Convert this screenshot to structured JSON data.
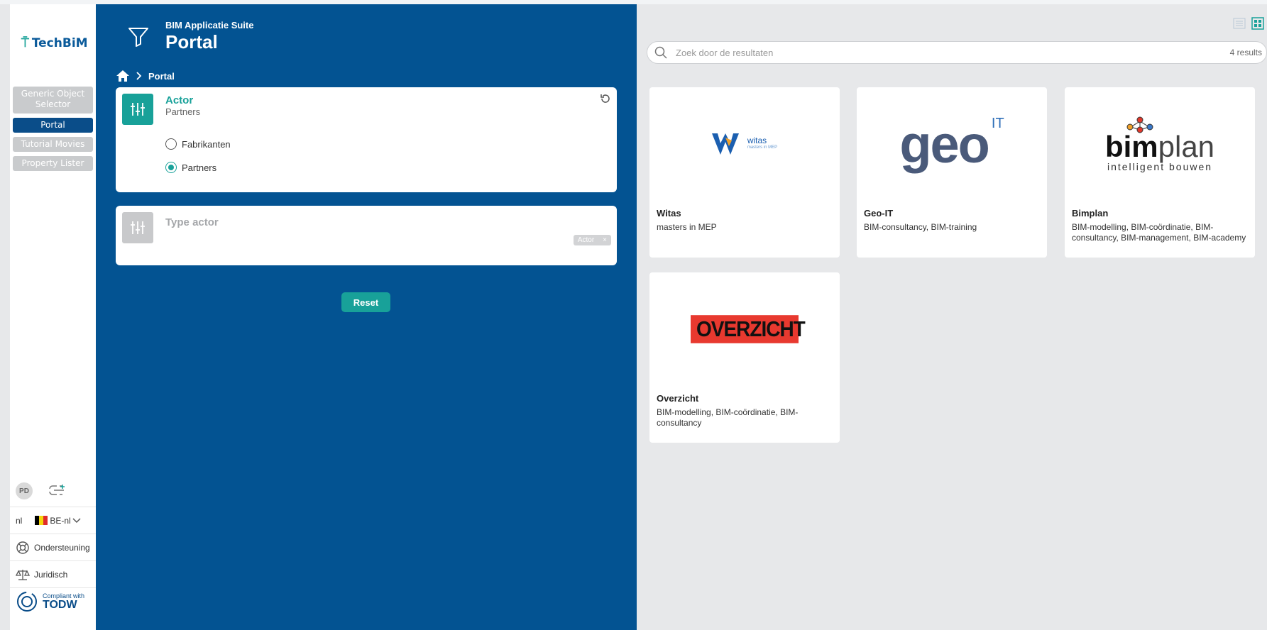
{
  "brand": {
    "name": "TechBiM"
  },
  "sidebar": {
    "items": [
      {
        "label": "Generic Object Selector",
        "active": false
      },
      {
        "label": "Portal",
        "active": true
      },
      {
        "label": "Tutorial Movies",
        "active": false
      },
      {
        "label": "Property Lister",
        "active": false
      }
    ],
    "user_initials": "PD",
    "language": "nl",
    "locale": "BE-nl",
    "support_label": "Ondersteuning",
    "legal_label": "Juridisch",
    "compliance_small": "Compliant with",
    "compliance_big": "TODW"
  },
  "header": {
    "suite": "BIM Applicatie Suite",
    "title": "Portal",
    "breadcrumb_current": "Portal"
  },
  "filters": {
    "actor": {
      "title": "Actor",
      "selected": "Partners",
      "options": [
        {
          "label": "Fabrikanten",
          "checked": false
        },
        {
          "label": "Partners",
          "checked": true
        }
      ]
    },
    "type_actor": {
      "title": "Type actor",
      "chip": "Actor",
      "chip_close": "×"
    },
    "reset_label": "Reset"
  },
  "results": {
    "search_placeholder": "Zoek door de resultaten",
    "count": "4 results",
    "items": [
      {
        "name": "Witas",
        "desc": "masters in MEP",
        "logo_text": "witas",
        "logo_sub": "masters in MEP"
      },
      {
        "name": "Geo-IT",
        "desc": "BIM-consultancy, BIM-training",
        "logo_text": "geo",
        "logo_sup": "IT"
      },
      {
        "name": "Bimplan",
        "desc": "BIM-modelling, BIM-coördinatie, BIM-consultancy, BIM-management, BIM-academy",
        "logo_text_bold": "bim",
        "logo_text_light": "plan",
        "logo_sub": "intelligent bouwen"
      },
      {
        "name": "Overzicht",
        "desc": "BIM-modelling, BIM-coördinatie, BIM-consultancy",
        "logo_text": "OVERZICHT"
      }
    ]
  },
  "colors": {
    "panel_blue": "#035392",
    "teal": "#18a199",
    "nav_active": "#0a4d89",
    "overzicht_red": "#e8392f"
  }
}
